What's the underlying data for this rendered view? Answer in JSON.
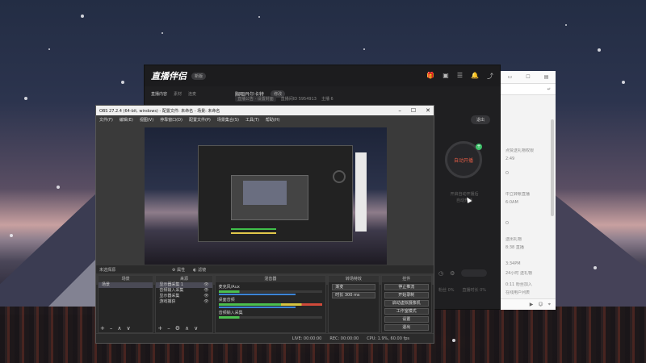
{
  "assistant": {
    "logo": "直播伴侣",
    "version_badge": "新版",
    "tabs": [
      "直播内容",
      "素材",
      "连麦"
    ],
    "live_title": "胸咽丹尔卡特",
    "edit_label": "修改",
    "sub_info": [
      "直播公告 · 设置封面",
      "直播间ID 5954913",
      "主播 6"
    ],
    "out_button": "退出",
    "start_label": "自动开播",
    "hint": [
      "开启自动开播后",
      "自动开播"
    ],
    "stats": [
      "粉丝 0%",
      "直播时长 0%",
      "观看 0%"
    ]
  },
  "chat": {
    "messages": [
      "点赞送礼物权限",
      "2:49",
      "O",
      "中立转帐直播",
      "6:0AM",
      "O",
      "送出礼物",
      "8:38 直播",
      "3:34PM",
      "24小时 送礼物",
      "0:11 粉丝加入",
      "在线用户列表"
    ]
  },
  "obs": {
    "title": "OBS 27.2.4 (64-bit, windows) - 配置文件: 未命名 - 场景: 未命名",
    "menu": [
      "文件(F)",
      "编辑(E)",
      "视图(V)",
      "停靠窗口(D)",
      "配置文件(P)",
      "场景集合(S)",
      "工具(T)",
      "帮助(H)"
    ],
    "no_source": "未选择源",
    "props_btn": "属性",
    "filters_btn": "滤镜",
    "scenes_header": "场景",
    "scenes": [
      "场景"
    ],
    "sources_header": "来源",
    "sources": [
      "显示器采集 1",
      "音频输入采集",
      "显示器采集",
      "游戏捕获"
    ],
    "mixer_header": "混音器",
    "mixer": [
      "麦克风/Aux",
      "桌面音频",
      "音频输入采集"
    ],
    "trans_header": "转场特效",
    "trans_type": "渐变",
    "duration_label": "时长",
    "duration_value": "300 ms",
    "controls_header": "控件",
    "controls": [
      "停止推流",
      "开始录制",
      "启动虚拟摄像机",
      "工作室模式",
      "设置",
      "退出"
    ],
    "status": [
      "LIVE: 00:00:00",
      "REC: 00:00:00",
      "CPU: 1.9%, 60.00 fps"
    ]
  },
  "colors": {
    "accent_red": "#e25c45",
    "accent_green": "#3fc16a",
    "obs_bg": "#2b2b2b"
  }
}
